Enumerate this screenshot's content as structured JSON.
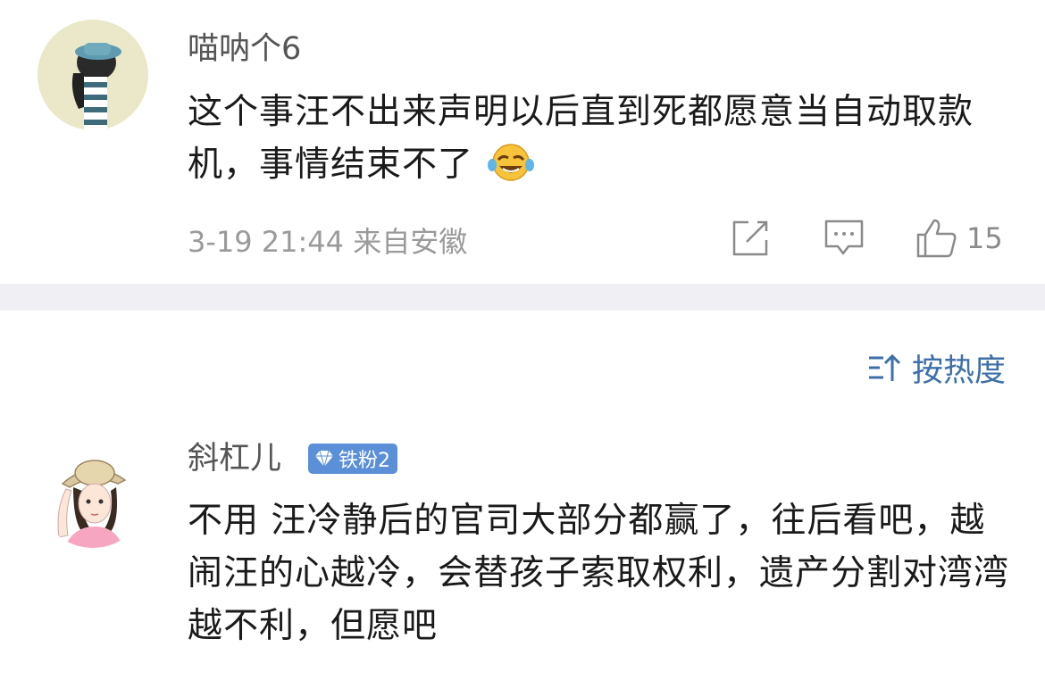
{
  "comments": [
    {
      "username": "喵呐个6",
      "text": "这个事汪不出来声明以后直到死都愿意当自动取款机，事情结束不了",
      "emoji": "laugh-cry-emoji",
      "meta": "3-19 21:44 来自安徽",
      "like_count": "15"
    },
    {
      "username": "斜杠儿",
      "badge": "铁粉2",
      "text": "不用 汪冷静后的官司大部分都赢了，往后看吧，越闹汪的心越冷，会替孩子索取权利，遗产分割对湾湾越不利，但愿吧"
    }
  ],
  "sort": {
    "label": "按热度"
  },
  "colors": {
    "divider": "#efeff4",
    "link": "#3d6fa8",
    "badge": "#5b8fd8",
    "meta": "#9a9a9a"
  }
}
